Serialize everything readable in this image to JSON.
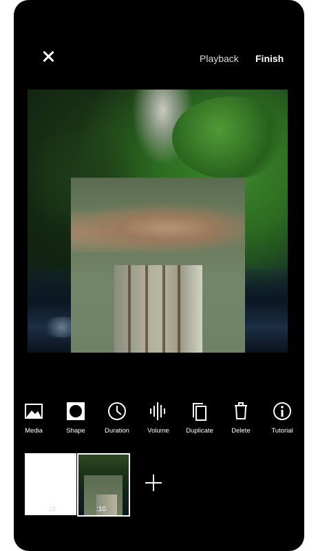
{
  "header": {
    "close_icon": "close-icon",
    "playback_label": "Playback",
    "finish_label": "Finish"
  },
  "toolbar": {
    "items": [
      {
        "label": "Media",
        "icon": "image-icon"
      },
      {
        "label": "Shape",
        "icon": "shape-icon"
      },
      {
        "label": "Duration",
        "icon": "clock-icon"
      },
      {
        "label": "Volume",
        "icon": "soundwave-icon"
      },
      {
        "label": "Duplicate",
        "icon": "duplicate-icon"
      },
      {
        "label": "Delete",
        "icon": "trash-icon"
      },
      {
        "label": "Tutorial",
        "icon": "info-icon"
      }
    ]
  },
  "timeline": {
    "clips": [
      {
        "duration": "10"
      },
      {
        "duration": ":10"
      }
    ],
    "add_icon": "plus-icon"
  },
  "colors": {
    "background": "#000000",
    "text": "#ffffff",
    "secondary_text": "#d9d9d9"
  }
}
